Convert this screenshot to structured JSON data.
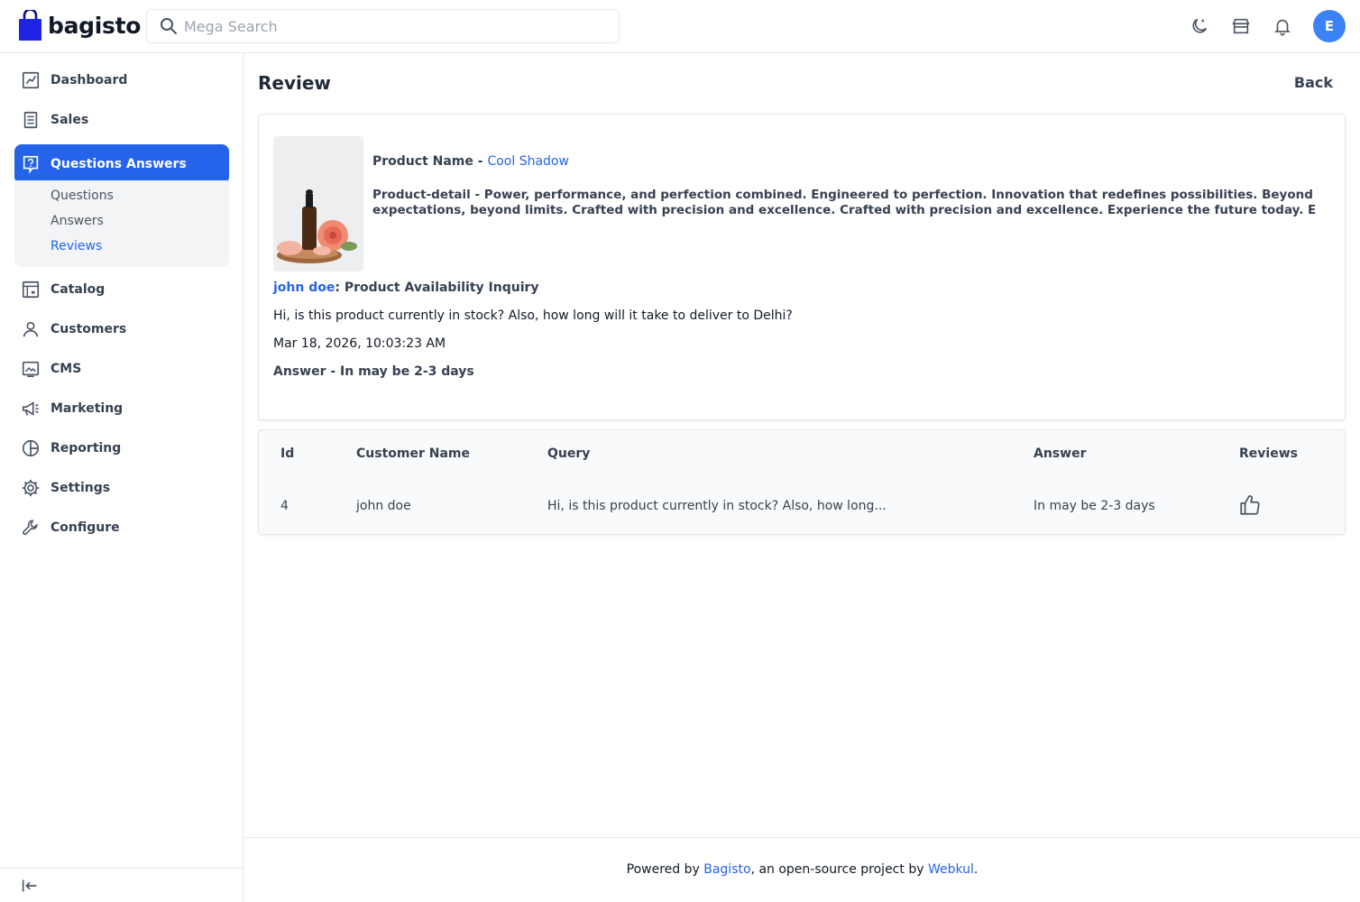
{
  "app": {
    "name": "bagisto"
  },
  "search": {
    "placeholder": "Mega Search"
  },
  "header": {
    "icons": [
      "moon-icon",
      "store-icon",
      "bell-icon"
    ],
    "avatar_initial": "E",
    "avatar_color": "#3b82f6"
  },
  "sidebar": {
    "items": [
      {
        "label": "Dashboard",
        "icon": "dashboard-icon"
      },
      {
        "label": "Sales",
        "icon": "receipt-icon"
      },
      {
        "label": "Questions Answers",
        "icon": "question-icon",
        "active": true
      },
      {
        "label": "Catalog",
        "icon": "catalog-icon"
      },
      {
        "label": "Customers",
        "icon": "user-icon"
      },
      {
        "label": "CMS",
        "icon": "cms-icon"
      },
      {
        "label": "Marketing",
        "icon": "megaphone-icon"
      },
      {
        "label": "Reporting",
        "icon": "pie-chart-icon"
      },
      {
        "label": "Settings",
        "icon": "gear-icon"
      },
      {
        "label": "Configure",
        "icon": "wrench-icon"
      }
    ],
    "subitems": [
      {
        "label": "Questions"
      },
      {
        "label": "Answers"
      },
      {
        "label": "Reviews",
        "current": true
      }
    ]
  },
  "page": {
    "title": "Review",
    "back_label": "Back"
  },
  "review": {
    "product_name_label": "Product Name -",
    "product_name": "Cool Shadow",
    "product_detail": "Product-detail - Power, performance, and perfection combined. Engineered to perfection. Innovation that redefines possibilities. Beyond expectations, beyond limits. Crafted with precision and excellence. Crafted with precision and excellence. Experience the future today. E",
    "customer": "john doe",
    "title_separator": ":",
    "question_title": "Product Availability Inquiry",
    "question_body": "Hi, is this product currently in stock? Also, how long will it take to deliver to Delhi?",
    "date": "Mar 18, 2026, 10:03:23 AM",
    "answer": "Answer - In may be 2-3 days"
  },
  "table": {
    "columns": [
      "Id",
      "Customer Name",
      "Query",
      "Answer",
      "Reviews"
    ],
    "rows": [
      {
        "id": "4",
        "customer_name": "john doe",
        "query": "Hi, is this product currently in stock? Also, how long...",
        "answer": "In may be 2-3 days",
        "reviews_icon": "thumbs-up-icon"
      }
    ]
  },
  "footer": {
    "prefix": "Powered by",
    "link1": "Bagisto",
    "middle": ", an open-source project by",
    "link2": "Webkul",
    "suffix": "."
  },
  "colors": {
    "accent": "#2563eb",
    "brand_logo": "#1d24e6"
  }
}
